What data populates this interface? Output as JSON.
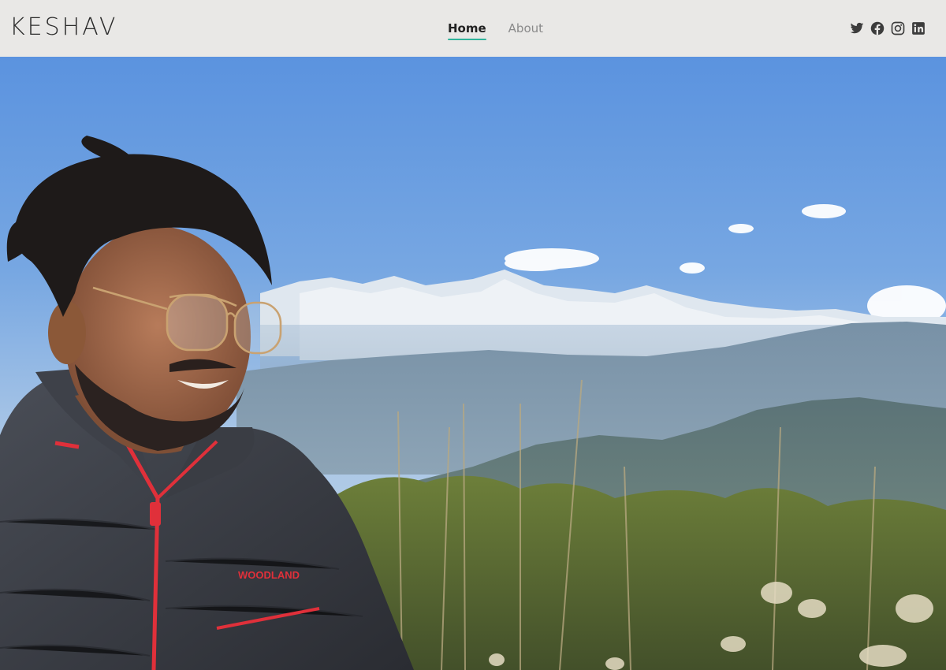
{
  "brand": {
    "name": "KESHAV"
  },
  "nav": {
    "links": [
      {
        "label": "Home",
        "active": true
      },
      {
        "label": "About",
        "active": false
      }
    ],
    "accent_color": "#2fb39b"
  },
  "socials": [
    {
      "icon": "twitter-icon"
    },
    {
      "icon": "facebook-icon"
    },
    {
      "icon": "instagram-icon"
    },
    {
      "icon": "linkedin-icon"
    }
  ],
  "hero": {
    "jacket_brand": "WOODLAND",
    "colors": {
      "sky_top": "#5a95e2",
      "sky_bottom": "#b7d0e8",
      "jacket": "#3a3d44",
      "zipper": "#e0303a"
    }
  }
}
